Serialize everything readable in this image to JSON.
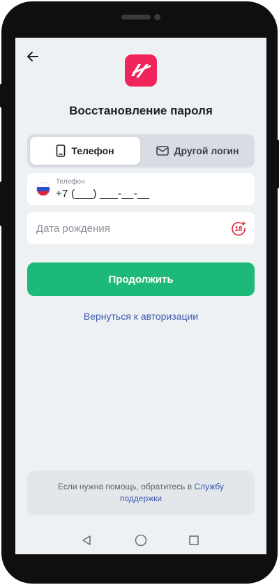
{
  "header": {
    "back_icon": "arrow-left-icon",
    "logo_icon": "brand-logo-icon",
    "title": "Восстановление пароля"
  },
  "tabs": [
    {
      "label": "Телефон",
      "icon": "smartphone-icon",
      "active": true
    },
    {
      "label": "Другой логин",
      "icon": "envelope-icon",
      "active": false
    }
  ],
  "phone_field": {
    "label": "Телефон",
    "value": "+7 (___) ___-__-__",
    "country_flag": "russia-flag-icon"
  },
  "dob_field": {
    "placeholder": "Дата рождения",
    "badge_icon": "age-18-plus-icon"
  },
  "continue_button": {
    "label": "Продолжить"
  },
  "back_to_login_link": {
    "label": "Вернуться к авторизации"
  },
  "help": {
    "text": "Если нужна помощь, обратитесь в ",
    "link": "Службу поддержки"
  },
  "system_nav": {
    "back": "triangle-back-icon",
    "home": "circle-home-icon",
    "recents": "square-recents-icon"
  },
  "colors": {
    "accent_green": "#1db97a",
    "link_blue": "#3d5ab0",
    "brand_red": "#f0245a",
    "background": "#eef1f4"
  }
}
